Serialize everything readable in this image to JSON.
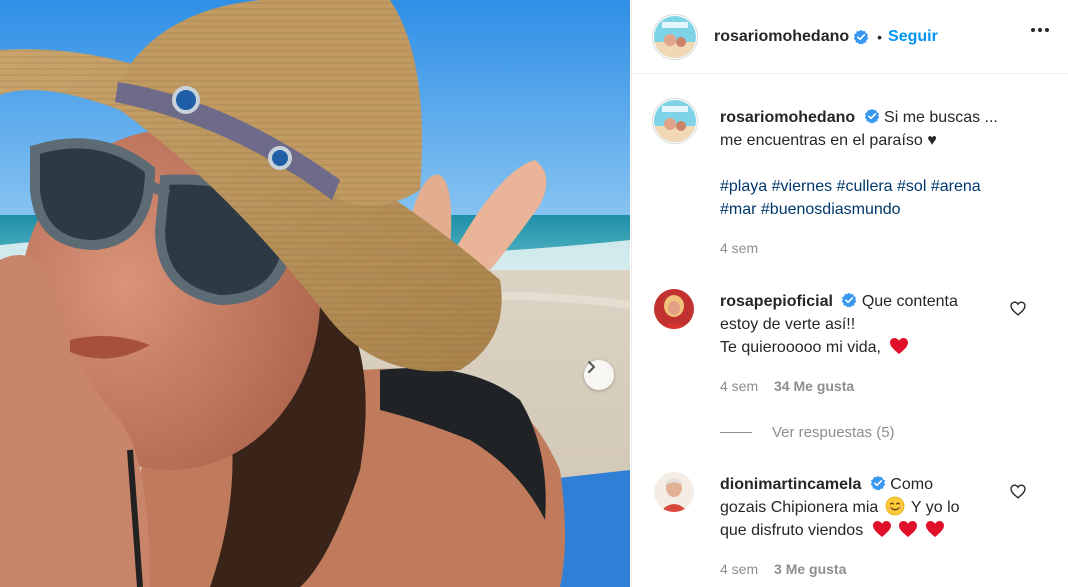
{
  "post": {
    "username": "rosariomohedano",
    "follow_label": "Seguir",
    "dot": "•",
    "caption_user": "rosariomohedano",
    "caption_line1": "Si me buscas ...",
    "caption_line2": "me encuentras en el paraíso ♥",
    "hashtags_line1": [
      "#playa",
      "#viernes",
      "#cullera",
      "#sol",
      "#arena"
    ],
    "hashtags_line2": [
      "#mar",
      "#buenosdiasmundo"
    ],
    "time": "4 sem"
  },
  "comments": [
    {
      "username": "rosapepioficial",
      "line1": "Que contenta",
      "line2": "estoy de verte así!!",
      "line3": "Te quierooooo mi vida,",
      "time": "4 sem",
      "likes": "34 Me gusta",
      "view_replies": "Ver respuestas (5)"
    },
    {
      "username": "dionimartincamela",
      "line1": "Como",
      "line2a": "gozais Chipionera mia",
      "line2b": "Y yo lo",
      "line3": "que disfruto viendos",
      "time": "4 sem",
      "likes": "3 Me gusta"
    }
  ],
  "colors": {
    "accent": "#0095f6",
    "verified": "#3897f0",
    "hashtag": "#00376b",
    "muted": "#8e8e8e",
    "heart_red": "#e0102a"
  },
  "icons": [
    "verified-badge-icon",
    "more-options-icon",
    "heart-outline-icon",
    "red-heart-emoji-icon",
    "smiling-face-emoji-icon",
    "chevron-right-icon"
  ]
}
